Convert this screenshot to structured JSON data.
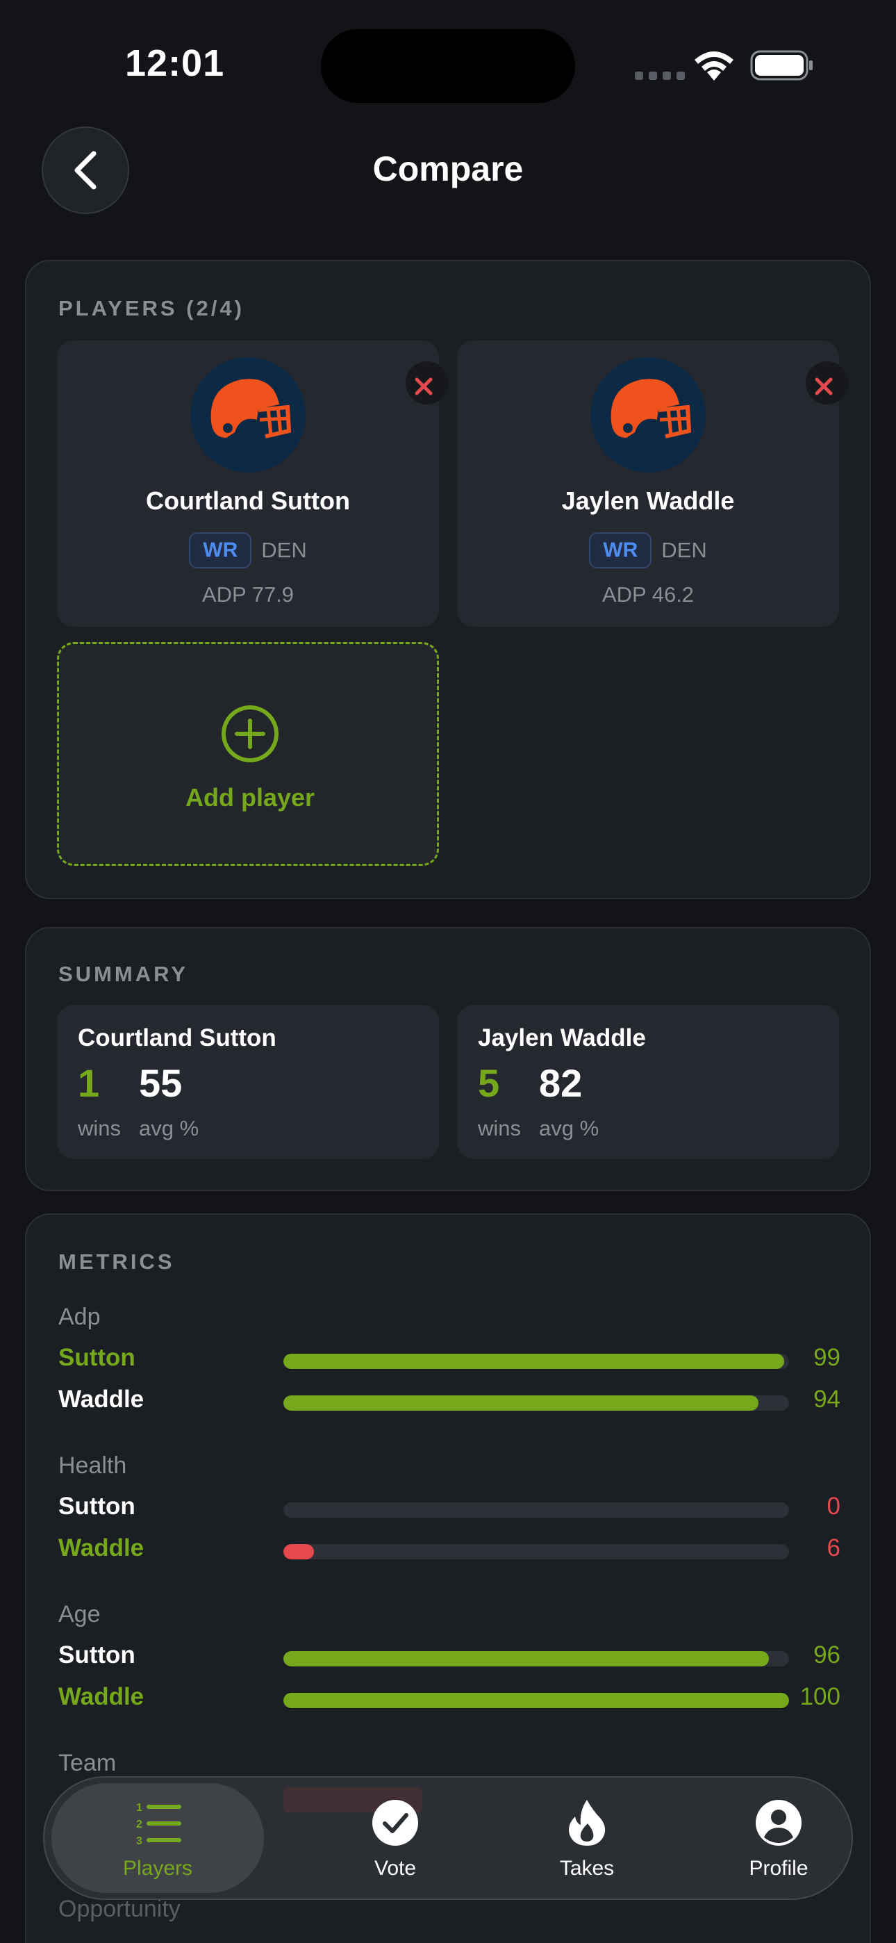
{
  "status_bar": {
    "time": "12:01"
  },
  "header": {
    "title": "Compare"
  },
  "players_section": {
    "label": "PLAYERS (2/4)",
    "players": [
      {
        "name": "Courtland Sutton",
        "position": "WR",
        "team": "DEN",
        "adp": "ADP 77.9"
      },
      {
        "name": "Jaylen Waddle",
        "position": "WR",
        "team": "DEN",
        "adp": "ADP 46.2"
      }
    ],
    "add_label": "Add player"
  },
  "summary_section": {
    "label": "SUMMARY",
    "items": [
      {
        "name": "Courtland Sutton",
        "wins": "1",
        "avg": "55",
        "wins_label": "wins",
        "avg_label": "avg %"
      },
      {
        "name": "Jaylen Waddle",
        "wins": "5",
        "avg": "82",
        "wins_label": "wins",
        "avg_label": "avg %"
      }
    ]
  },
  "metrics_section": {
    "label": "METRICS",
    "metrics": [
      {
        "title": "Adp",
        "rows": [
          {
            "name": "Sutton",
            "value": "99",
            "fill": 0.99,
            "leader": true
          },
          {
            "name": "Waddle",
            "value": "94",
            "fill": 0.94,
            "leader": false
          }
        ]
      },
      {
        "title": "Health",
        "rows": [
          {
            "name": "Sutton",
            "value": "0",
            "fill": 0.0,
            "leader": false
          },
          {
            "name": "Waddle",
            "value": "6",
            "fill": 0.06,
            "leader": true
          }
        ]
      },
      {
        "title": "Age",
        "rows": [
          {
            "name": "Sutton",
            "value": "96",
            "fill": 0.96,
            "leader": false
          },
          {
            "name": "Waddle",
            "value": "100",
            "fill": 1.0,
            "leader": true
          }
        ]
      }
    ],
    "partial_titles": [
      "Team",
      "Opportunity"
    ]
  },
  "tab_bar": {
    "tabs": [
      {
        "label": "Players",
        "icon": "ranked-list-icon",
        "active": true
      },
      {
        "label": "Vote",
        "icon": "check-circle-icon",
        "active": false
      },
      {
        "label": "Takes",
        "icon": "flame-icon",
        "active": false
      },
      {
        "label": "Profile",
        "icon": "person-circle-icon",
        "active": false
      }
    ]
  },
  "colors": {
    "accent": "#76a81c",
    "negative": "#e5484d",
    "position_badge": "#4e8cf0",
    "helmet": "#f0521e"
  }
}
